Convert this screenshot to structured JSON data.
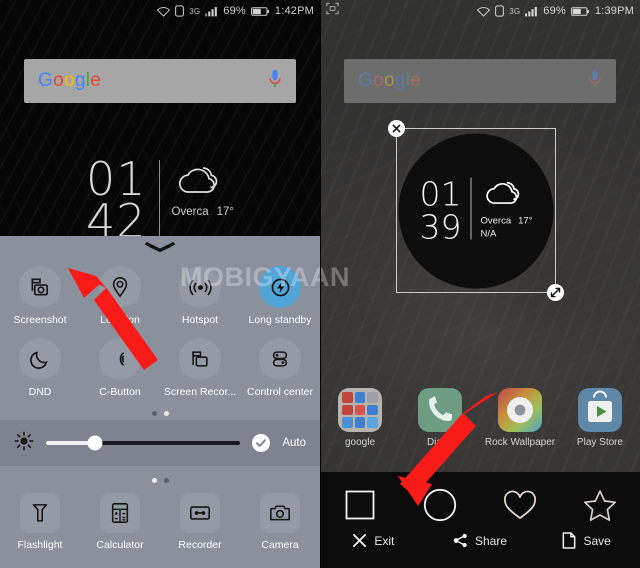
{
  "left_panel": {
    "status_bar": {
      "wifi_icon": "wifi-icon",
      "sim_icon": "sim-card-icon",
      "network_type": "3G",
      "signal_icon": "signal-bars-icon",
      "battery_percent": "69%",
      "battery_icon": "battery-icon",
      "time": "1:42PM"
    },
    "search": {
      "logo_g": "G",
      "logo_o1": "o",
      "logo_o2": "o",
      "logo_g2": "g",
      "logo_l": "l",
      "logo_e": "e",
      "mic_icon": "microphone-icon"
    },
    "clock_widget": {
      "hour": "01",
      "minute": "42",
      "weather_icon": "cloud-icon",
      "condition": "Overca",
      "temperature": "17°"
    },
    "quick_settings": {
      "handle_icon": "chevron-down-icon",
      "tiles": [
        {
          "label": "Screenshot",
          "icon": "screenshot-icon",
          "active": false
        },
        {
          "label": "Location",
          "icon": "location-pin-icon",
          "active": false
        },
        {
          "label": "Hotspot",
          "icon": "hotspot-icon",
          "active": false
        },
        {
          "label": "Long standby",
          "icon": "battery-saver-icon",
          "active": true
        },
        {
          "label": "DND",
          "icon": "moon-icon",
          "active": false
        },
        {
          "label": "C-Button",
          "icon": "c-button-icon",
          "active": false
        },
        {
          "label": "Screen Recor...",
          "icon": "screen-record-icon",
          "active": false
        },
        {
          "label": "Control center",
          "icon": "control-center-icon",
          "active": false
        }
      ],
      "page_dots_top": [
        "off",
        "on"
      ],
      "page_dots_bottom": [
        "on",
        "off"
      ]
    },
    "brightness": {
      "icon": "brightness-sun-icon",
      "value_percent": 25,
      "auto_label": "Auto",
      "auto_checked": true,
      "check_icon": "check-icon"
    },
    "shortcuts": [
      {
        "label": "Flashlight",
        "icon": "flashlight-icon"
      },
      {
        "label": "Calculator",
        "icon": "calculator-icon"
      },
      {
        "label": "Recorder",
        "icon": "recorder-icon"
      },
      {
        "label": "Camera",
        "icon": "camera-icon"
      }
    ]
  },
  "right_panel": {
    "status_bar": {
      "capture_icon": "screen-capture-icon",
      "wifi_icon": "wifi-icon",
      "sim_icon": "sim-card-icon",
      "network_type": "3G",
      "signal_icon": "signal-bars-icon",
      "battery_percent": "69%",
      "battery_icon": "battery-icon",
      "time": "1:39PM"
    },
    "search": {
      "logo_g": "G",
      "logo_o1": "o",
      "logo_o2": "o",
      "logo_g2": "g",
      "logo_l": "l",
      "logo_e": "e",
      "mic_icon": "microphone-icon"
    },
    "crop_selection": {
      "close_icon": "close-x-icon",
      "resize_icon": "resize-handle-icon",
      "shape": "circle",
      "content": {
        "hour": "01",
        "minute": "39",
        "weather_icon": "cloud-icon",
        "condition": "Overca",
        "temperature": "17°",
        "extra": "N/A"
      }
    },
    "apps": [
      {
        "label": "google",
        "icon": "folder-icon"
      },
      {
        "label": "Dialer",
        "icon": "phone-icon",
        "color": "#6f9d83"
      },
      {
        "label": "Rock Wallpaper",
        "icon": "wallpaper-icon",
        "color": "#b0995f"
      },
      {
        "label": "Play Store",
        "icon": "play-store-icon",
        "color": "#5e87a8"
      }
    ],
    "edit_toolbar": {
      "shapes": [
        {
          "name": "square-shape-tool",
          "selected": false
        },
        {
          "name": "circle-shape-tool",
          "selected": true
        },
        {
          "name": "heart-shape-tool",
          "selected": false
        },
        {
          "name": "star-shape-tool",
          "selected": false
        }
      ],
      "actions": [
        {
          "label": "Exit",
          "icon": "close-x-icon"
        },
        {
          "label": "Share",
          "icon": "share-icon"
        },
        {
          "label": "Save",
          "icon": "save-document-icon"
        }
      ]
    }
  },
  "overlay": {
    "watermark": "MOBIGYAAN",
    "arrow_color": "#f81b18",
    "annotation_arrows": [
      {
        "name": "arrow-to-screenshot-tile",
        "target": "Screenshot"
      },
      {
        "name": "arrow-to-circle-shape-tool",
        "target": "circle-shape-tool"
      }
    ]
  }
}
